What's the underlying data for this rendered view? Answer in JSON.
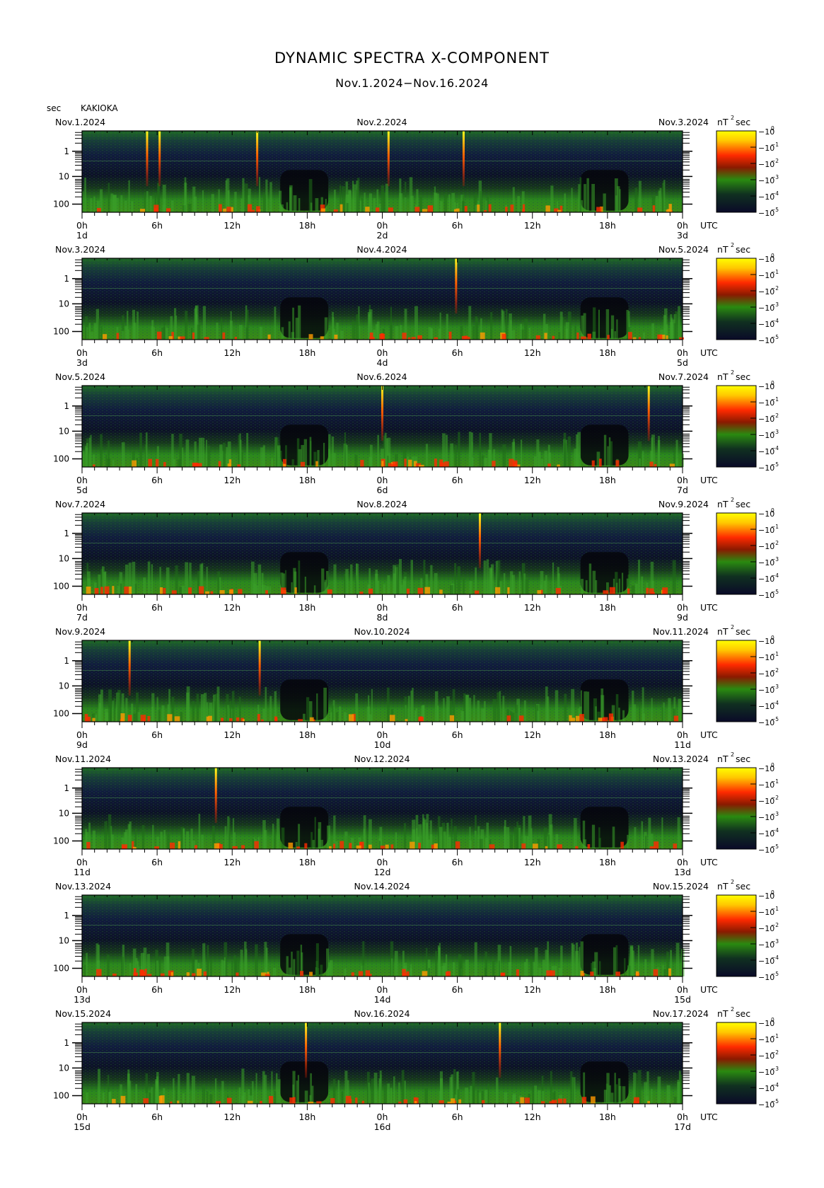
{
  "title": "DYNAMIC SPECTRA X-COMPONENT",
  "subtitle": "Nov.1.2024−Nov.16.2024",
  "ylabel": "sec",
  "station": "KAKIOKA",
  "unit_label": "nT",
  "unit_exp": "2",
  "unit_suffix": "sec",
  "utc_label": "UTC",
  "time_ticks": [
    "0h",
    "6h",
    "12h",
    "18h",
    "0h",
    "6h",
    "12h",
    "18h",
    "0h"
  ],
  "period_ticks": [
    "1",
    "10",
    "100"
  ],
  "colorbar_ticks": [
    "10",
    "10",
    "10",
    "10",
    "10",
    "10"
  ],
  "colorbar_exps": [
    "0",
    "−1",
    "−2",
    "−3",
    "−4",
    "−5"
  ],
  "colors": {
    "low": "#0b0b1e",
    "mid": "#1f7a1f",
    "high": "#ff2000",
    "peak": "#ffee00"
  },
  "chart_data": {
    "type": "heatmap",
    "title": "DYNAMIC SPECTRA X-COMPONENT",
    "y_scale": "log",
    "colorbar_range": [
      "10^-5",
      "10^0"
    ],
    "panels": [
      {
        "left": "Nov.1.2024",
        "center": "Nov.2.2024",
        "right": "Nov.3.2024",
        "day_start": "1d",
        "day_mid": "2d",
        "day_end": "3d",
        "spikes": [
          5.2,
          6.2,
          14.0,
          24.5,
          30.5
        ]
      },
      {
        "left": "Nov.3.2024",
        "center": "Nov.4.2024",
        "right": "Nov.5.2024",
        "day_start": "3d",
        "day_mid": "4d",
        "day_end": "5d",
        "spikes": [
          29.9
        ]
      },
      {
        "left": "Nov.5.2024",
        "center": "Nov.6.2024",
        "right": "Nov.7.2024",
        "day_start": "5d",
        "day_mid": "6d",
        "day_end": "7d",
        "spikes": [
          24.0,
          45.3
        ]
      },
      {
        "left": "Nov.7.2024",
        "center": "Nov.8.2024",
        "right": "Nov.9.2024",
        "day_start": "7d",
        "day_mid": "8d",
        "day_end": "9d",
        "spikes": [
          31.8
        ]
      },
      {
        "left": "Nov.9.2024",
        "center": "Nov.10.2024",
        "right": "Nov.11.2024",
        "day_start": "9d",
        "day_mid": "10d",
        "day_end": "11d",
        "spikes": [
          3.8,
          14.2
        ]
      },
      {
        "left": "Nov.11.2024",
        "center": "Nov.12.2024",
        "right": "Nov.13.2024",
        "day_start": "11d",
        "day_mid": "12d",
        "day_end": "13d",
        "spikes": [
          10.7
        ]
      },
      {
        "left": "Nov.13.2024",
        "center": "Nov.14.2024",
        "right": "Nov.15.2024",
        "day_start": "13d",
        "day_mid": "14d",
        "day_end": "15d",
        "spikes": []
      },
      {
        "left": "Nov.15.2024",
        "center": "Nov.16.2024",
        "right": "Nov.17.2024",
        "day_start": "15d",
        "day_mid": "16d",
        "day_end": "17d",
        "spikes": [
          17.9,
          33.4
        ]
      }
    ]
  }
}
